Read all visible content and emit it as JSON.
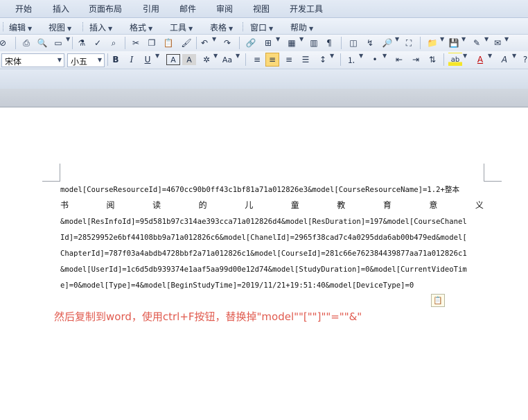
{
  "tabs": [
    "开始",
    "插入",
    "页面布局",
    "引用",
    "邮件",
    "审阅",
    "视图",
    "开发工具"
  ],
  "menus": [
    "编辑",
    "视图",
    "插入",
    "格式",
    "工具",
    "表格",
    "窗口",
    "帮助"
  ],
  "font": {
    "name": "宋体",
    "size": "小五"
  },
  "format_buttons": {
    "bold": "B",
    "italic": "I",
    "underline": "U",
    "border": "A",
    "char_shade": "A",
    "font_color": "A",
    "highlight": "ab"
  },
  "document": {
    "lines": [
      "model[CourseResourceId]=4670cc90b0ff43c1bf81a71a012826e3&model[CourseResourceName]=1.2+整本",
      "&model[ResInfoId]=95d581b97c314ae393cca71a012826d4&model[ResDuration]=197&model[CourseChanel",
      "Id]=28529952e6bf44108bb9a71a012826c6&model[ChanelId]=2965f38cad7c4a0295dda6ab00b479ed&model[",
      "ChapterId]=787f03a4abdb4728bbf2a71a012826c1&model[CourseId]=281c66e762384439877aa71a012826c1",
      "&model[UserId]=1c6d5db939374e1aaf5aa99d00e12d74&model[StudyDuration]=0&model[CurrentVideoTim",
      "e]=0&model[Type]=4&model[BeginStudyTime]=2019/11/21+19:51:40&model[DeviceType]=0"
    ],
    "cjk_line": [
      "书",
      "阅",
      "读",
      "的",
      "儿",
      "童",
      "教",
      "育",
      "意",
      "义"
    ]
  },
  "annotation": "然后复制到word，使用ctrl+F按钮，替换掉\"model\"\"[\"\"]\"\"=\"\"&\"",
  "colors": {
    "annotation": "#e05a4e",
    "highlight_button": "#fbd97a"
  }
}
